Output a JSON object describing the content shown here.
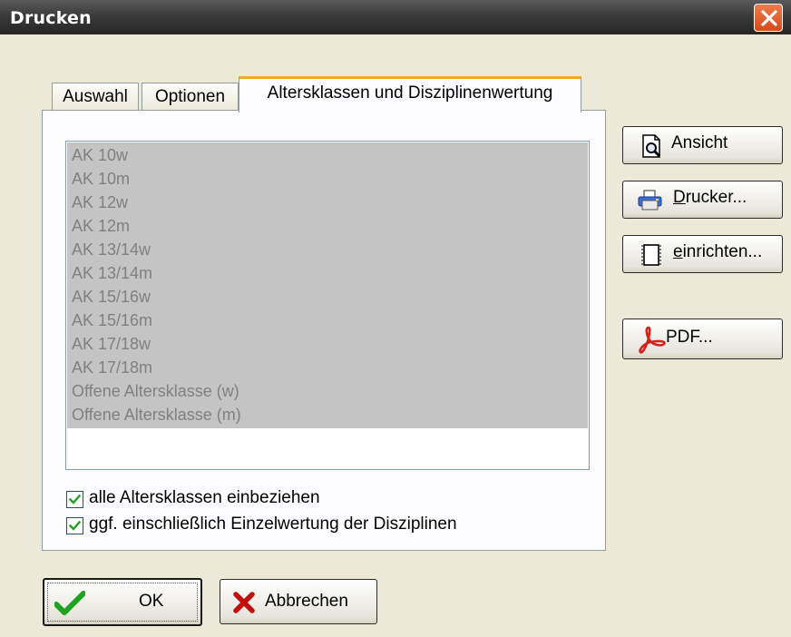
{
  "window": {
    "title": "Drucken",
    "close_icon": "close-icon"
  },
  "tabs": [
    {
      "label": "Auswahl",
      "active": false
    },
    {
      "label": "Optionen",
      "active": false
    },
    {
      "label": "Altersklassen und Disziplinenwertung",
      "active": true
    }
  ],
  "agegroups": [
    "AK 10w",
    "AK 10m",
    "AK 12w",
    "AK 12m",
    "AK 13/14w",
    "AK 13/14m",
    "AK 15/16w",
    "AK 15/16m",
    "AK 17/18w",
    "AK 17/18m",
    "Offene Altersklasse (w)",
    "Offene Altersklasse (m)"
  ],
  "options": {
    "all_agegroups": {
      "label": "alle Altersklassen einbeziehen",
      "checked": true
    },
    "single_discipline": {
      "label": "ggf. einschließlich Einzelwertung der Disziplinen",
      "checked": true
    }
  },
  "side_buttons": {
    "preview": {
      "label": "Ansicht",
      "icon": "preview-icon"
    },
    "printer": {
      "underline": "D",
      "rest": "rucker...",
      "icon": "printer-icon"
    },
    "setup": {
      "underline": "e",
      "rest": "inrichten...",
      "icon": "page-setup-icon"
    },
    "pdf": {
      "label": "PDF...",
      "icon": "pdf-icon"
    }
  },
  "bottom_buttons": {
    "ok": {
      "label": "OK",
      "icon": "checkmark-icon"
    },
    "cancel": {
      "label": "Abbrechen",
      "icon": "cross-icon"
    }
  },
  "colors": {
    "tab_active_accent": "#f5a623",
    "selection": "#c4c4c4",
    "ok_green": "#1fa31f",
    "cancel_red": "#c01010"
  }
}
